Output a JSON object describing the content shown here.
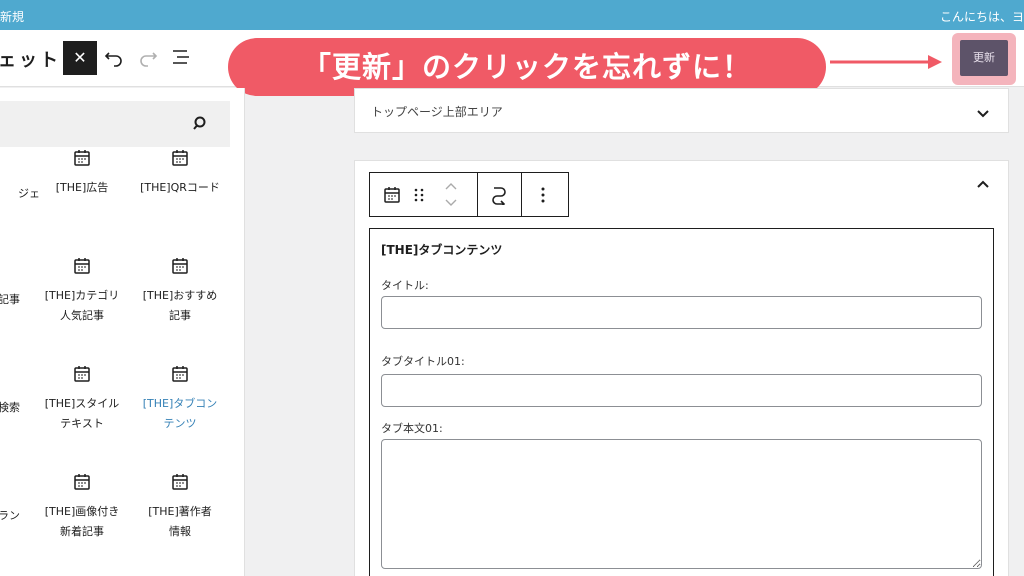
{
  "admin_bar": {
    "left_text": "新規",
    "right_text": "こんにちは、ヨ"
  },
  "header": {
    "title_partial": "ェット",
    "close_label": "✕"
  },
  "annotation": {
    "text": "「更新」のクリックを忘れずに！"
  },
  "update_button": {
    "label": "更新"
  },
  "sidebar": {
    "search_placeholder": "",
    "blocks": [
      {
        "label": "ジェ",
        "partial": true
      },
      {
        "label": "[THE]広告"
      },
      {
        "label": "[THE]QRコード"
      },
      {
        "label": "記事",
        "partial": true
      },
      {
        "label": "[THE]カテゴリ人気記事"
      },
      {
        "label": "[THE]おすすめ記事"
      },
      {
        "label": "検索",
        "partial": true
      },
      {
        "label": "[THE]スタイルテキスト"
      },
      {
        "label": "[THE]タブコンテンツ",
        "selected": true
      },
      {
        "label": "ラン",
        "partial": true
      },
      {
        "label": "[THE]画像付き新着記事"
      },
      {
        "label": "[THE]著作者情報"
      }
    ]
  },
  "canvas": {
    "panel1_label": "トップページ上部エリア",
    "form": {
      "title": "[THE]タブコンテンツ",
      "field_title_label": "タイトル:",
      "field_tab_title_label": "タブタイトル01:",
      "field_tab_body_label": "タブ本文01:",
      "field_title_value": "",
      "field_tab_title_value": "",
      "field_tab_body_value": ""
    }
  },
  "colors": {
    "admin_bar": "#4fa9cf",
    "annotation": "#f05a66",
    "update_button": "#5d5369",
    "selected_block": "#3581b6"
  }
}
